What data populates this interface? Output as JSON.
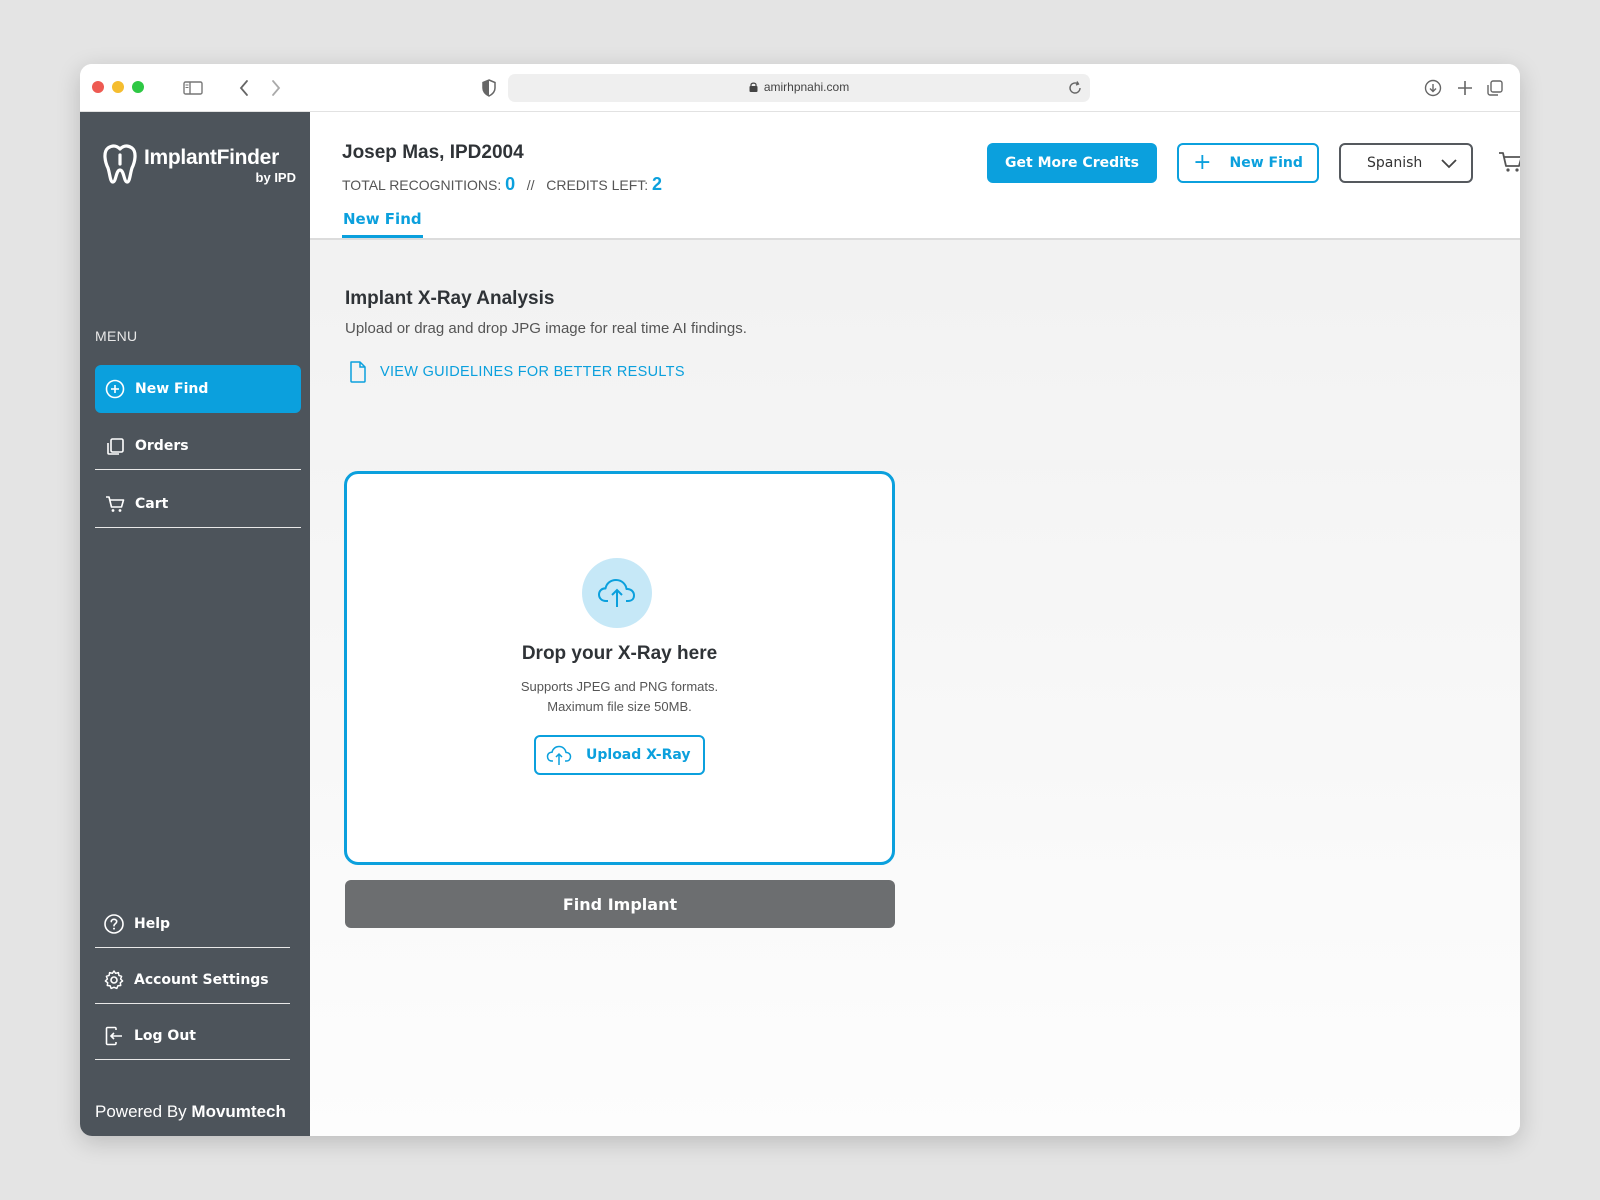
{
  "browser": {
    "url": "amirhpnahi.com"
  },
  "sidebar": {
    "logo_title": "ImplantFinder",
    "logo_sub": "by IPD",
    "menu_label": "MENU",
    "items": [
      {
        "label": "New Find",
        "icon": "plus-circle-icon",
        "active": true
      },
      {
        "label": "Orders",
        "icon": "orders-icon",
        "active": false
      },
      {
        "label": "Cart",
        "icon": "cart-icon",
        "active": false
      }
    ],
    "bottom_items": [
      {
        "label": "Help",
        "icon": "help-icon"
      },
      {
        "label": "Account Settings",
        "icon": "gear-icon"
      },
      {
        "label": "Log Out",
        "icon": "logout-icon"
      }
    ],
    "powered_prefix": "Powered By",
    "powered_brand": "Movumtech"
  },
  "header": {
    "user_name": "Josep Mas, IPD2004",
    "total_recognitions_label": "TOTAL RECOGNITIONS:",
    "total_recognitions_value": "0",
    "separator": "//",
    "credits_left_label": "CREDITS LEFT:",
    "credits_left_value": "2",
    "tab_label": "New Find",
    "get_credits_label": "Get More Credits",
    "new_find_label": "New Find",
    "language": "Spanish"
  },
  "main": {
    "title": "Implant X-Ray Analysis",
    "subtitle": "Upload or drag and drop JPG image for real time AI findings.",
    "guidelines_link": "VIEW GUIDELINES FOR BETTER RESULTS",
    "drop_title": "Drop your X-Ray here",
    "drop_info_1": "Supports JPEG and PNG formats.",
    "drop_info_2": "Maximum file size 50MB.",
    "upload_label": "Upload X-Ray",
    "find_label": "Find Implant"
  },
  "colors": {
    "accent": "#0ba0dd",
    "sidebar": "#4d545b",
    "disabled_button": "#6c6e70"
  }
}
